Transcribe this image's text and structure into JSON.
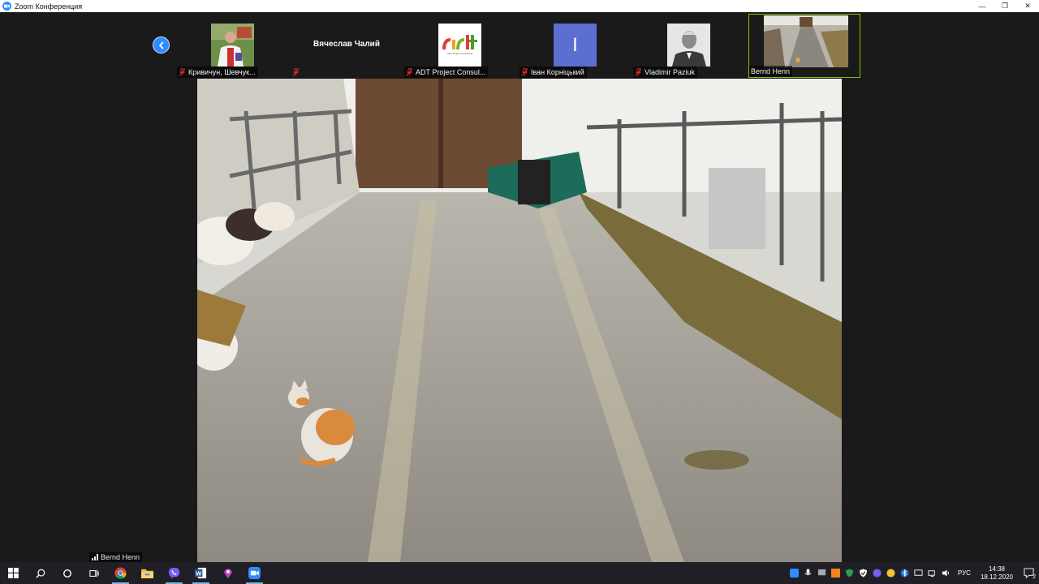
{
  "window": {
    "title": "Zoom Конференция",
    "minimize": "—",
    "restore": "❐",
    "close": "✕"
  },
  "participants": [
    {
      "name": "Кривичун, Шевчук...",
      "muted": true,
      "has_video": false,
      "avatar": "photo-man-embroidered-shirt"
    },
    {
      "name": "",
      "display_name": "Вячеслав Чалий",
      "muted": true,
      "has_video": false,
      "avatar": "none"
    },
    {
      "name": "ADT Project Consul...",
      "muted": true,
      "has_video": false,
      "avatar": "adt-logo"
    },
    {
      "name": "Іван Корніцький",
      "muted": true,
      "has_video": false,
      "avatar": "initial",
      "initial": "I",
      "avatar_color": "#5b6fd0"
    },
    {
      "name": "Vladimir Paziuk",
      "muted": true,
      "has_video": false,
      "avatar": "photo-grayscale-man"
    },
    {
      "name": "Bernd Henn",
      "muted": false,
      "has_video": true,
      "avatar": "video-thumbnail",
      "active_speaker": true
    }
  ],
  "adt_logo": {
    "wordmark": "ADT Project Consulting"
  },
  "main_video": {
    "speaker": "Bernd Henn",
    "scene": "barn-feeding-alley-with-cat"
  },
  "colors": {
    "accent": "#2d8cff",
    "active_border": "#7ec400",
    "mute_red": "#e02828"
  },
  "taskbar": {
    "apps": [
      "windows-start-icon",
      "search-icon",
      "cortana-icon",
      "task-view-icon",
      "chrome-icon",
      "file-explorer-icon",
      "viber-icon",
      "word-icon",
      "maps-icon",
      "zoom-icon"
    ],
    "language": "РУС",
    "time": "14:38",
    "date": "18.12.2020",
    "notification_count": "2"
  }
}
